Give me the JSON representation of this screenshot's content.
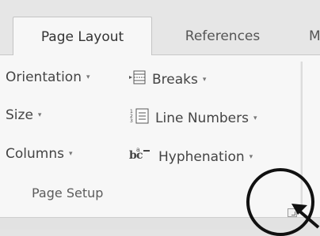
{
  "tabs": {
    "active": "Page Layout",
    "references": "References",
    "next_partial": "M"
  },
  "page_setup": {
    "orientation": "Orientation",
    "size": "Size",
    "columns": "Columns",
    "breaks": "Breaks",
    "line_numbers": "Line Numbers",
    "hyphenation": "Hyphenation",
    "group_label": "Page Setup",
    "dropdown_caret": "▾"
  },
  "icons": {
    "breaks": "breaks-icon",
    "line_numbers": "line-numbers-icon",
    "hyphenation": "hyphenation-icon",
    "launcher": "dialog-launcher-icon"
  },
  "annotation": {
    "highlight": "circle-highlight",
    "pointer": "arrow-pointer"
  }
}
